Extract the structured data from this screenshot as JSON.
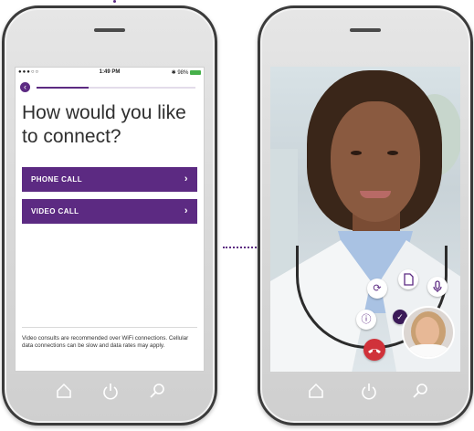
{
  "status_bar": {
    "carrier": "●●●○○",
    "time": "1:49 PM",
    "battery": "✱ 98%"
  },
  "connect_screen": {
    "back_icon": "chevron-left-icon",
    "progress_percent": 33,
    "title": "How would you like to connect?",
    "options": [
      {
        "label": "PHONE CALL",
        "icon": "chevron-right-icon"
      },
      {
        "label": "VIDEO CALL",
        "icon": "chevron-right-icon"
      }
    ],
    "footnote": "Video consults are recommended over WiFi connections. Cellular data connections can be slow and data rates may apply."
  },
  "video_screen": {
    "controls": [
      {
        "name": "switch-camera-icon",
        "glyph": "⟳"
      },
      {
        "name": "document-icon",
        "glyph": "▯"
      },
      {
        "name": "microphone-icon",
        "glyph": "🎙"
      },
      {
        "name": "info-icon",
        "glyph": "ⓘ"
      },
      {
        "name": "end-call-icon",
        "glyph": "☎"
      }
    ]
  },
  "softkeys": [
    {
      "name": "home-icon",
      "glyph": "⌂"
    },
    {
      "name": "power-icon",
      "glyph": "⏻"
    },
    {
      "name": "search-icon",
      "glyph": "⚲"
    }
  ],
  "colors": {
    "accent": "#5c2a82",
    "end_call": "#d0323a"
  }
}
